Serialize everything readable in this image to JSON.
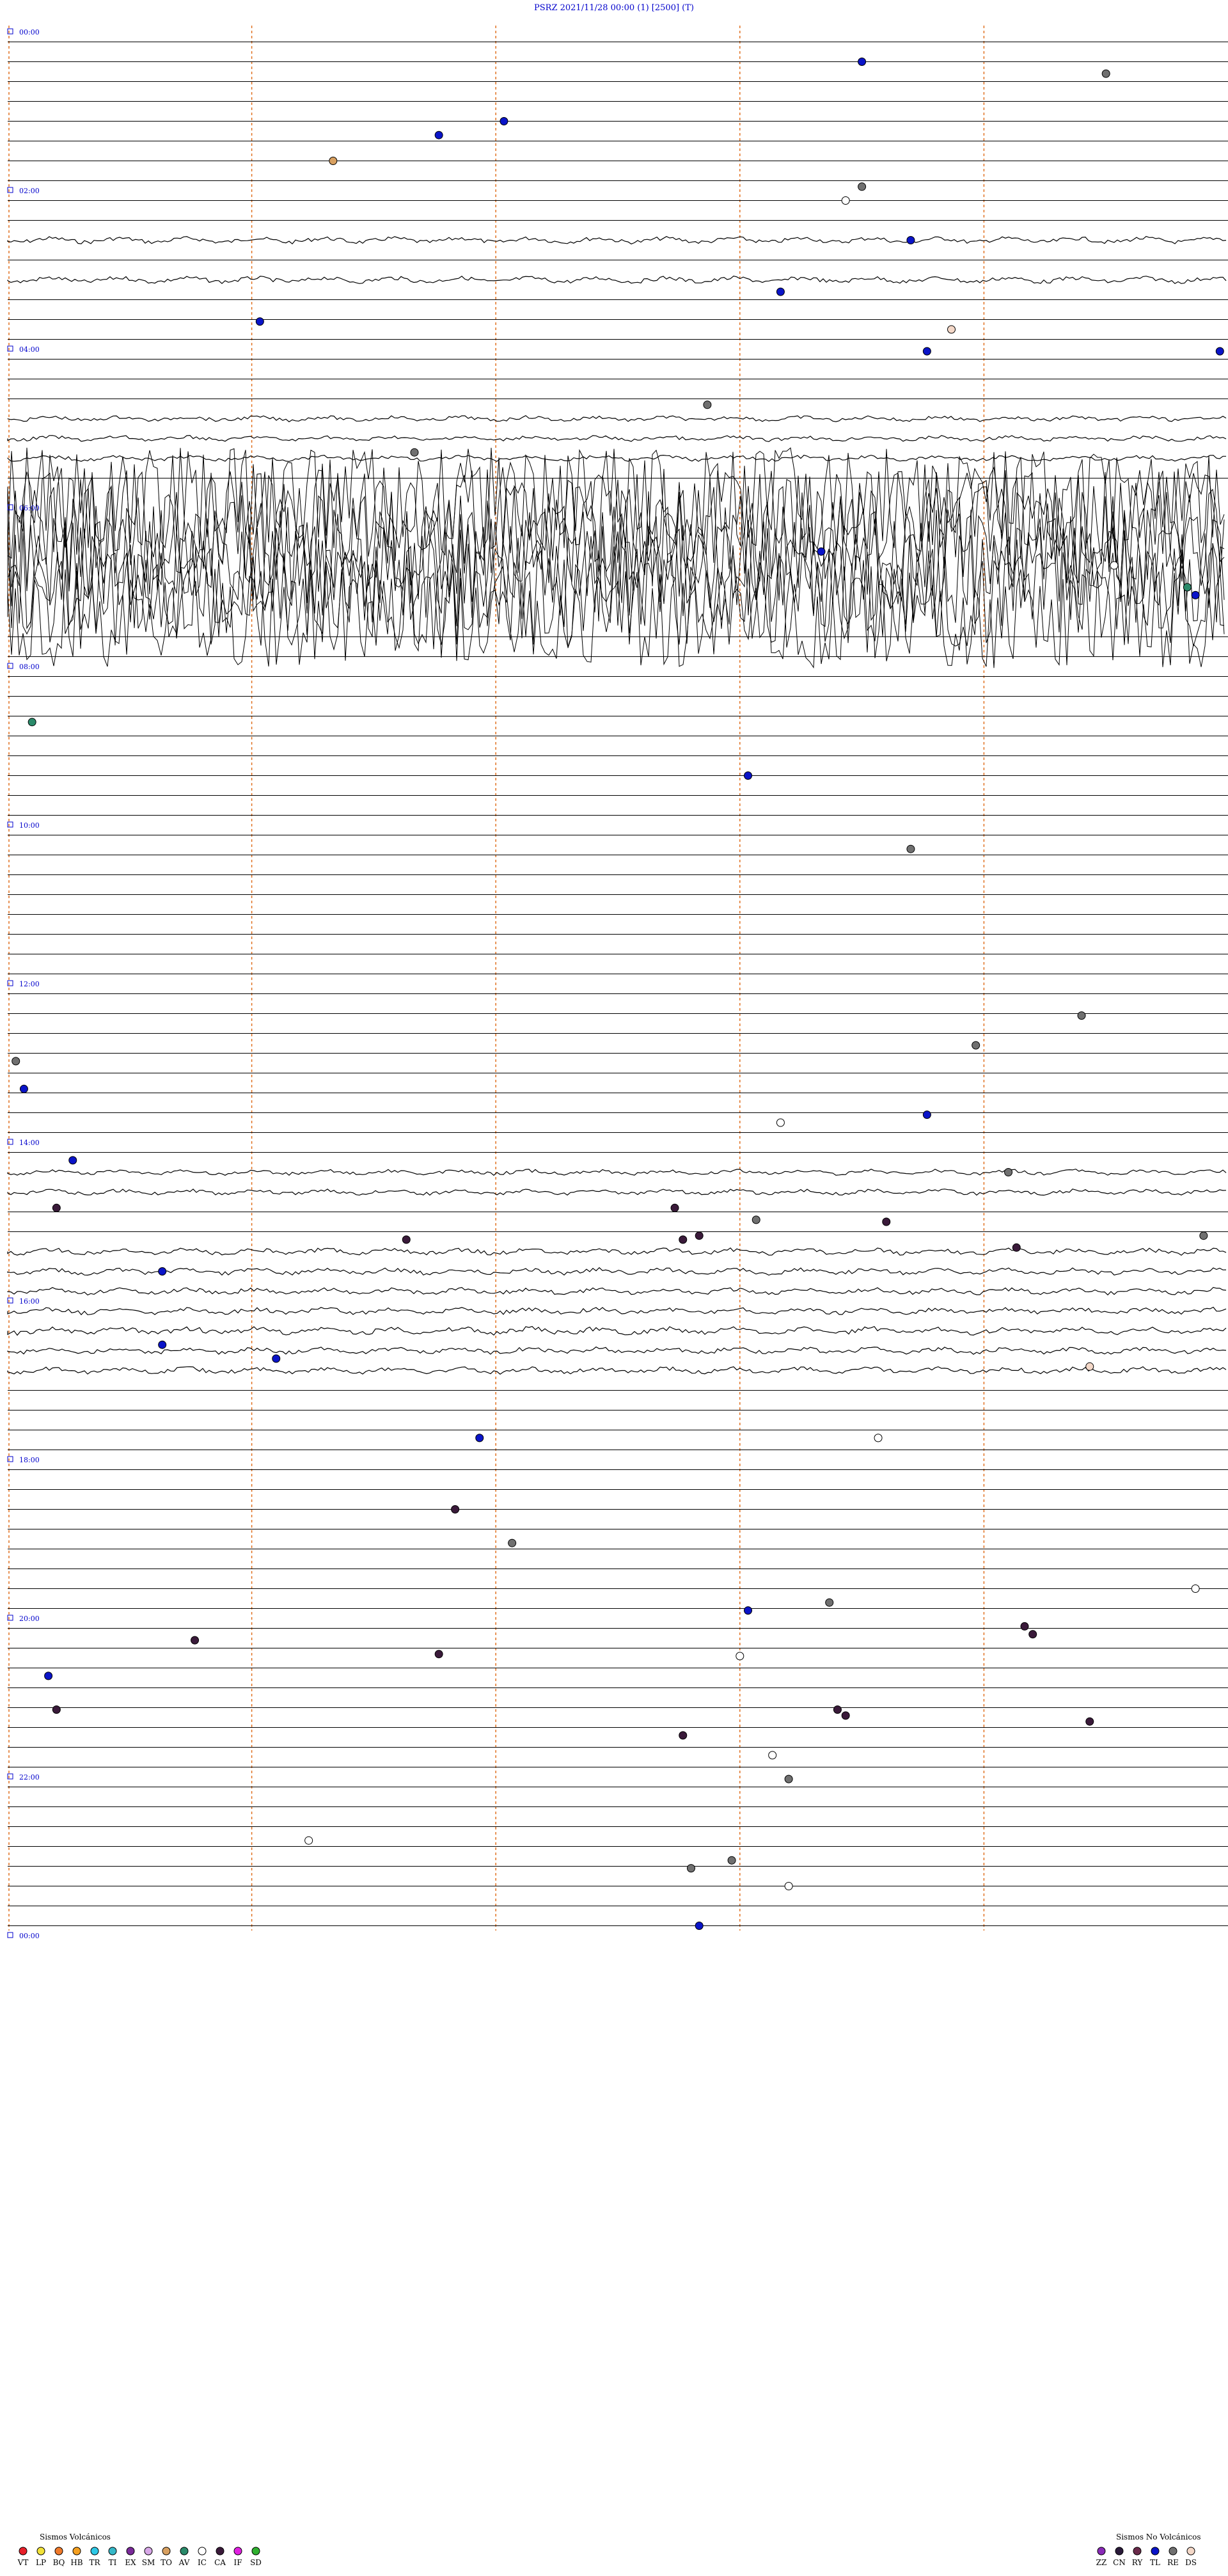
{
  "header": {
    "station": "PSRZ",
    "datetime": "2021/11/28 00:00",
    "param1": "(1)",
    "param2": "[2500]",
    "param3": "(T)"
  },
  "chart_data": {
    "type": "helicorder",
    "title": "PSRZ    2021/11/28 00:00      (1)    [2500]   (T)",
    "x_minutes_per_row": 15,
    "rows_total": 96,
    "minute_markers": [
      0,
      3,
      6,
      9,
      12
    ],
    "hour_labels": [
      {
        "row": 0,
        "label": "00:00"
      },
      {
        "row": 8,
        "label": "02:00"
      },
      {
        "row": 16,
        "label": "04:00"
      },
      {
        "row": 24,
        "label": "06:00"
      },
      {
        "row": 32,
        "label": "08:00"
      },
      {
        "row": 40,
        "label": "10:00"
      },
      {
        "row": 48,
        "label": "12:00"
      },
      {
        "row": 56,
        "label": "14:00"
      },
      {
        "row": 64,
        "label": "16:00"
      },
      {
        "row": 72,
        "label": "18:00"
      },
      {
        "row": 80,
        "label": "20:00"
      },
      {
        "row": 88,
        "label": "22:00"
      },
      {
        "row": 96,
        "label": "00:00"
      }
    ],
    "noisy_rows": [
      {
        "row": 10,
        "amp": 6
      },
      {
        "row": 12,
        "amp": 6
      },
      {
        "row": 19,
        "amp": 5
      },
      {
        "row": 20,
        "amp": 5
      },
      {
        "row": 21,
        "amp": 5
      },
      {
        "row": 57,
        "amp": 5
      },
      {
        "row": 58,
        "amp": 5
      },
      {
        "row": 61,
        "amp": 6
      },
      {
        "row": 62,
        "amp": 6
      },
      {
        "row": 63,
        "amp": 6
      },
      {
        "row": 64,
        "amp": 6
      },
      {
        "row": 65,
        "amp": 7
      },
      {
        "row": 66,
        "amp": 6
      },
      {
        "row": 67,
        "amp": 6
      }
    ],
    "saturated_rows": [
      23,
      24,
      25,
      26,
      27,
      28,
      29
    ],
    "events": [
      {
        "row": 1.5,
        "minute": 10.5,
        "type": "TL"
      },
      {
        "row": 2.1,
        "minute": 13.5,
        "type": "RE"
      },
      {
        "row": 4.5,
        "minute": 6.1,
        "type": "TL"
      },
      {
        "row": 5.2,
        "minute": 5.3,
        "type": "TL"
      },
      {
        "row": 6.5,
        "minute": 4.0,
        "type": "TO"
      },
      {
        "row": 7.8,
        "minute": 10.5,
        "type": "RE"
      },
      {
        "row": 8.5,
        "minute": 10.3,
        "type": "IC"
      },
      {
        "row": 10.5,
        "minute": 11.1,
        "type": "TL"
      },
      {
        "row": 13.1,
        "minute": 9.5,
        "type": "TL"
      },
      {
        "row": 14.6,
        "minute": 3.1,
        "type": "TL"
      },
      {
        "row": 15.0,
        "minute": 11.6,
        "type": "DS"
      },
      {
        "row": 16.1,
        "minute": 11.3,
        "type": "TL"
      },
      {
        "row": 16.1,
        "minute": 14.9,
        "type": "TL"
      },
      {
        "row": 18.8,
        "minute": 8.6,
        "type": "RE"
      },
      {
        "row": 21.2,
        "minute": 5.0,
        "type": "RE"
      },
      {
        "row": 26.2,
        "minute": 10.0,
        "type": "TL"
      },
      {
        "row": 26.9,
        "minute": 13.6,
        "type": "IC"
      },
      {
        "row": 28.0,
        "minute": 14.5,
        "type": "AV"
      },
      {
        "row": 28.4,
        "minute": 14.6,
        "type": "TL"
      },
      {
        "row": 34.8,
        "minute": 0.3,
        "type": "AV"
      },
      {
        "row": 37.5,
        "minute": 9.1,
        "type": "TL"
      },
      {
        "row": 41.2,
        "minute": 11.1,
        "type": "RE"
      },
      {
        "row": 49.6,
        "minute": 13.2,
        "type": "RE"
      },
      {
        "row": 51.1,
        "minute": 11.9,
        "type": "RE"
      },
      {
        "row": 51.9,
        "minute": 0.1,
        "type": "RE"
      },
      {
        "row": 53.3,
        "minute": 0.2,
        "type": "TL"
      },
      {
        "row": 54.6,
        "minute": 11.3,
        "type": "TL"
      },
      {
        "row": 55.0,
        "minute": 9.5,
        "type": "IC"
      },
      {
        "row": 56.9,
        "minute": 0.8,
        "type": "TL"
      },
      {
        "row": 57.5,
        "minute": 12.3,
        "type": "RE"
      },
      {
        "row": 59.3,
        "minute": 0.6,
        "type": "CA"
      },
      {
        "row": 59.3,
        "minute": 8.2,
        "type": "CA"
      },
      {
        "row": 59.9,
        "minute": 9.2,
        "type": "RE"
      },
      {
        "row": 60.0,
        "minute": 10.8,
        "type": "CA"
      },
      {
        "row": 60.7,
        "minute": 8.5,
        "type": "CA"
      },
      {
        "row": 60.7,
        "minute": 14.7,
        "type": "RE"
      },
      {
        "row": 60.9,
        "minute": 4.9,
        "type": "CA"
      },
      {
        "row": 60.9,
        "minute": 8.3,
        "type": "CA"
      },
      {
        "row": 61.3,
        "minute": 12.4,
        "type": "CA"
      },
      {
        "row": 62.5,
        "minute": 1.9,
        "type": "TL"
      },
      {
        "row": 66.2,
        "minute": 1.9,
        "type": "TL"
      },
      {
        "row": 66.9,
        "minute": 3.3,
        "type": "TL"
      },
      {
        "row": 67.3,
        "minute": 13.3,
        "type": "DS"
      },
      {
        "row": 70.9,
        "minute": 5.8,
        "type": "TL"
      },
      {
        "row": 70.9,
        "minute": 10.7,
        "type": "IC"
      },
      {
        "row": 74.5,
        "minute": 5.5,
        "type": "CA"
      },
      {
        "row": 76.2,
        "minute": 6.2,
        "type": "RE"
      },
      {
        "row": 78.5,
        "minute": 14.6,
        "type": "IC"
      },
      {
        "row": 79.6,
        "minute": 9.1,
        "type": "TL"
      },
      {
        "row": 79.2,
        "minute": 10.1,
        "type": "RE"
      },
      {
        "row": 80.4,
        "minute": 12.5,
        "type": "CA"
      },
      {
        "row": 80.8,
        "minute": 12.6,
        "type": "CA"
      },
      {
        "row": 81.1,
        "minute": 2.3,
        "type": "CA"
      },
      {
        "row": 81.8,
        "minute": 5.3,
        "type": "CA"
      },
      {
        "row": 81.9,
        "minute": 9.0,
        "type": "IC"
      },
      {
        "row": 82.9,
        "minute": 0.5,
        "type": "TL"
      },
      {
        "row": 84.6,
        "minute": 0.6,
        "type": "CA"
      },
      {
        "row": 84.6,
        "minute": 10.2,
        "type": "CA"
      },
      {
        "row": 84.9,
        "minute": 10.3,
        "type": "CA"
      },
      {
        "row": 85.2,
        "minute": 13.3,
        "type": "CA"
      },
      {
        "row": 85.9,
        "minute": 8.3,
        "type": "CA"
      },
      {
        "row": 86.9,
        "minute": 9.4,
        "type": "IC"
      },
      {
        "row": 88.1,
        "minute": 9.6,
        "type": "RE"
      },
      {
        "row": 91.2,
        "minute": 3.7,
        "type": "IC"
      },
      {
        "row": 92.2,
        "minute": 8.9,
        "type": "RE"
      },
      {
        "row": 92.6,
        "minute": 8.4,
        "type": "RE"
      },
      {
        "row": 93.5,
        "minute": 9.6,
        "type": "IC"
      },
      {
        "row": 95.5,
        "minute": 8.5,
        "type": "TL"
      }
    ],
    "legend": {
      "volcanic": {
        "title": "Sismos Volcánicos",
        "codes": [
          "VT",
          "LP",
          "BQ",
          "HB",
          "TR",
          "TI",
          "EX",
          "SM",
          "TO",
          "AV",
          "IC",
          "CA",
          "IF",
          "SD"
        ]
      },
      "non_volcanic": {
        "title": "Sismos No Volcánicos",
        "codes": [
          "ZZ",
          "CN",
          "RY",
          "TL",
          "RE",
          "DS"
        ]
      }
    },
    "colors": {
      "VT": "#e8202a",
      "LP": "#f2e23a",
      "BQ": "#f07a2a",
      "HB": "#f5a020",
      "TR": "#2ec8e6",
      "TI": "#36b8c8",
      "EX": "#7a2a9a",
      "SM": "#d8a8e8",
      "TO": "#d8a060",
      "AV": "#2a8a6a",
      "IC": "#ffffff",
      "CA": "#3a1a3a",
      "IF": "#e020e0",
      "SD": "#30b030",
      "ZZ": "#8a2ab8",
      "CN": "#2a1a3a",
      "RY": "#6a2a4a",
      "TL": "#0a14c8",
      "RE": "#707070",
      "DS": "#f4d8c8"
    },
    "trace_color": "#000000",
    "marker_line_color": "#e07020",
    "label_color": "#0000cc"
  }
}
